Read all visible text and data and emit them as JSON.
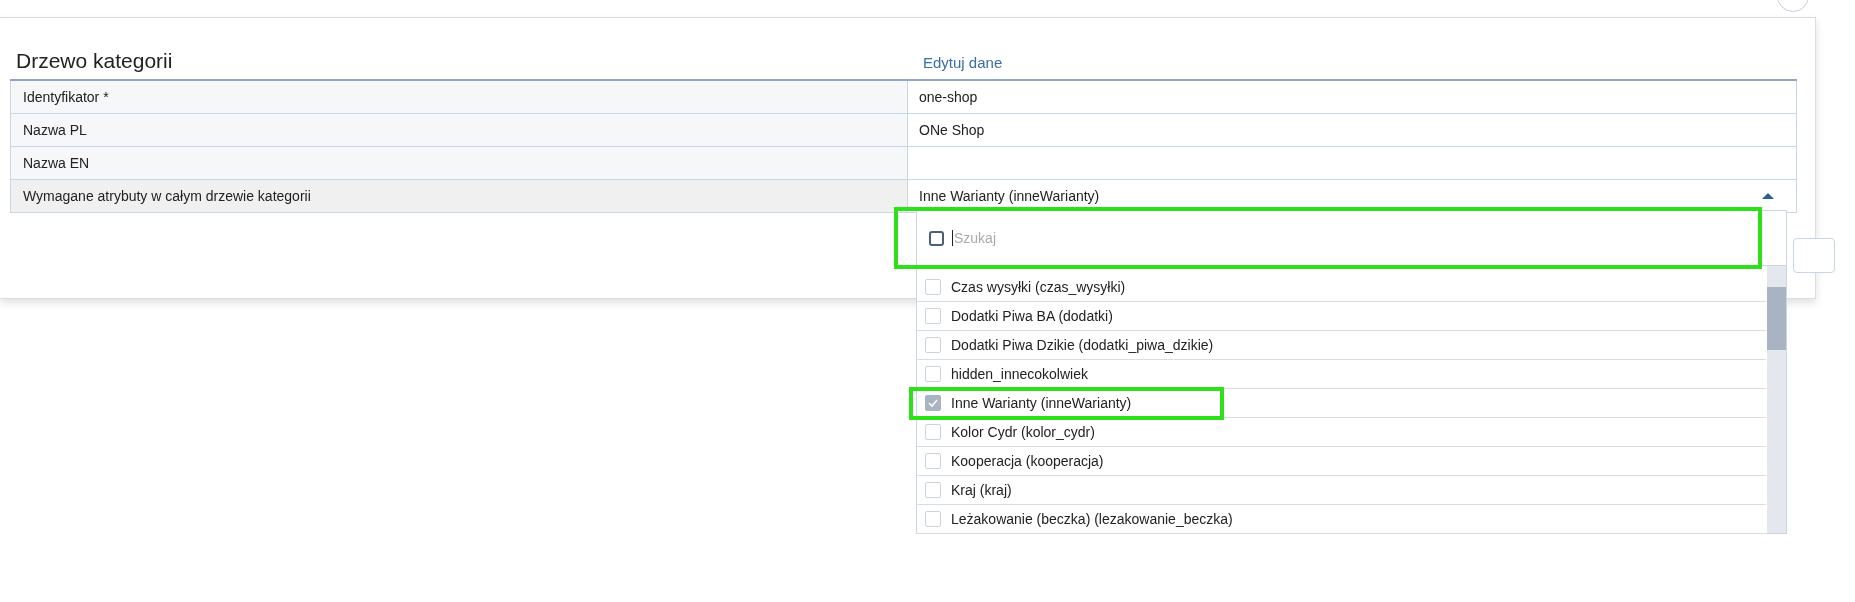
{
  "panel": {
    "title": "Drzewo kategorii",
    "edit_link": "Edytuj dane"
  },
  "fields": [
    {
      "label": "Identyfikator *",
      "value": "one-shop"
    },
    {
      "label": "Nazwa PL",
      "value": "ONe Shop"
    },
    {
      "label": "Nazwa EN"
    },
    {
      "label": "Wymagane atrybuty w całym drzewie kategorii",
      "value": "Inne Warianty (inneWarianty)",
      "kind": "multiselect",
      "expanded": true
    }
  ],
  "dropdown": {
    "search": {
      "placeholder": "Szukaj",
      "checked": false,
      "highlighted": true
    },
    "options": [
      {
        "label": "Czas wysyłki (czas_wysyłki)",
        "checked": false,
        "highlighted": false
      },
      {
        "label": "Dodatki Piwa BA (dodatki)",
        "checked": false,
        "highlighted": false
      },
      {
        "label": "Dodatki Piwa Dzikie (dodatki_piwa_dzikie)",
        "checked": false,
        "highlighted": false
      },
      {
        "label": "hidden_innecokolwiek",
        "checked": false,
        "highlighted": false
      },
      {
        "label": "Inne Warianty (inneWarianty)",
        "checked": true,
        "highlighted": true
      },
      {
        "label": "Kolor Cydr (kolor_cydr)",
        "checked": false,
        "highlighted": false
      },
      {
        "label": "Kooperacja (kooperacja)",
        "checked": false,
        "highlighted": false
      },
      {
        "label": "Kraj (kraj)",
        "checked": false,
        "highlighted": false
      },
      {
        "label": "Leżakowanie (beczka) (lezakowanie_beczka)",
        "checked": false,
        "highlighted": false
      }
    ]
  }
}
